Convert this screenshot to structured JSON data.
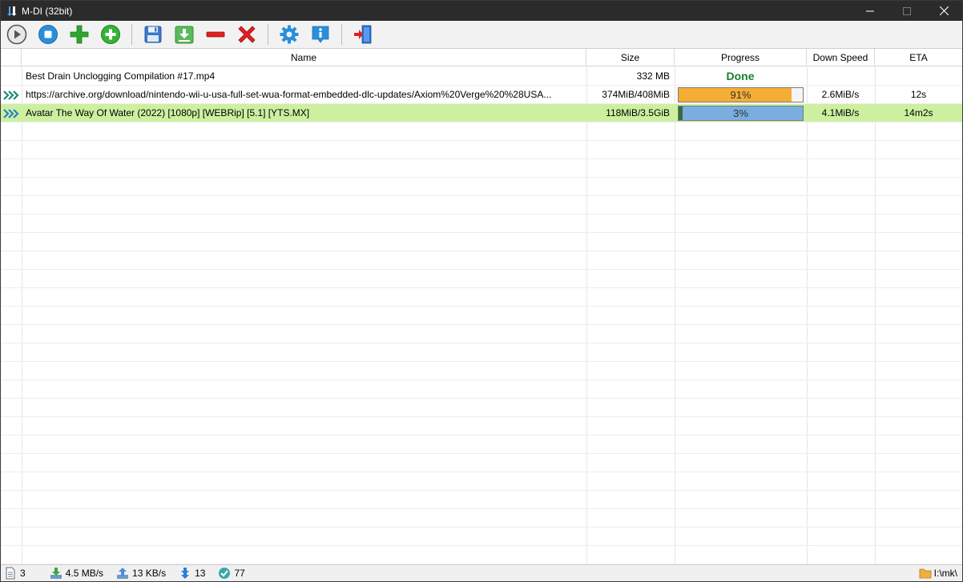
{
  "window": {
    "title": "M-DI (32bit)",
    "minimize": "—",
    "maximize": "☐",
    "close": "✕"
  },
  "toolbar": {
    "buttons": [
      {
        "name": "start-icon",
        "color": "#5a5a5a"
      },
      {
        "name": "stop-icon",
        "color": "#2a8fd8"
      },
      {
        "name": "add-icon",
        "color": "#2ea52e"
      },
      {
        "name": "add-circle-icon",
        "color": "#2ea52e"
      },
      {
        "name": "save-icon",
        "color": "#3a78c8"
      },
      {
        "name": "download-icon",
        "color": "#4aa84a"
      },
      {
        "name": "remove-icon",
        "color": "#e02020"
      },
      {
        "name": "delete-icon",
        "color": "#e02020"
      },
      {
        "name": "settings-icon",
        "color": "#2a8fd8"
      },
      {
        "name": "info-icon",
        "color": "#2a8fd8"
      },
      {
        "name": "exit-icon",
        "color": "#2a6fd0"
      }
    ]
  },
  "table": {
    "columns": {
      "name": "Name",
      "size": "Size",
      "progress": "Progress",
      "speed": "Down Speed",
      "eta": "ETA"
    },
    "rows": [
      {
        "status": "done",
        "name": "Best Drain Unclogging Compilation #17.mp4",
        "size": "332 MB",
        "progress_label": "Done",
        "progress": 1.0,
        "speed": "",
        "eta": ""
      },
      {
        "status": "downloading",
        "name": "https://archive.org/download/nintendo-wii-u-usa-full-set-wua-format-embedded-dlc-updates/Axiom%20Verge%20%28USA...",
        "size": "374MiB/408MiB",
        "progress_label": "91%",
        "progress": 0.91,
        "progress_color": "#f4ae35",
        "speed": "2.6MiB/s",
        "eta": "12s"
      },
      {
        "status": "downloading",
        "selected": true,
        "name": "Avatar The Way Of Water (2022) [1080p] [WEBRip] [5.1] [YTS.MX]",
        "size": "118MiB/3.5GiB",
        "progress_label": "3%",
        "progress": 0.03,
        "progress_color": "#7aaee0",
        "speed": "4.1MiB/s",
        "eta": "14m2s"
      }
    ]
  },
  "statusbar": {
    "count": "3",
    "down_speed": "4.5 MB/s",
    "up_speed": "13 KB/s",
    "active": "13",
    "connections": "77",
    "path": "I:\\mk\\"
  }
}
